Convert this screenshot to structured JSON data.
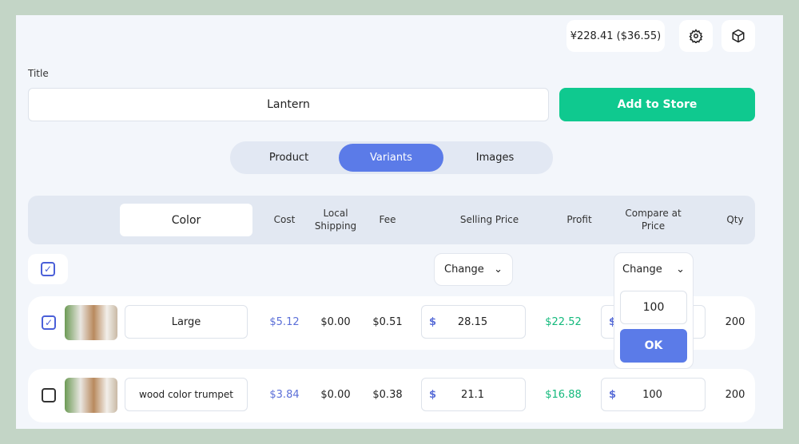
{
  "header": {
    "balance": "¥228.41 ($36.55)",
    "icons": [
      "gear-icon",
      "package-icon"
    ]
  },
  "title_label": "Title",
  "title_value": "Lantern",
  "add_button": "Add to Store",
  "tabs": [
    {
      "label": "Product"
    },
    {
      "label": "Variants",
      "active": true
    },
    {
      "label": "Images"
    }
  ],
  "columns": {
    "color": "Color",
    "cost": "Cost",
    "local_shipping": "Local Shipping",
    "fee": "Fee",
    "selling_price": "Selling Price",
    "profit": "Profit",
    "compare_at_price": "Compare at Price",
    "qty": "Qty"
  },
  "bulk": {
    "selling_change": "Change",
    "compare_change": "Change",
    "popup_value": "100",
    "ok": "OK"
  },
  "rows": [
    {
      "checked": true,
      "name": "Large",
      "cost": "$5.12",
      "shipping": "$0.00",
      "fee": "$0.51",
      "currency": "$",
      "selling": "28.15",
      "profit": "$22.52",
      "compare": "100",
      "qty": "200"
    },
    {
      "checked": false,
      "name": "wood color trumpet",
      "cost": "$3.84",
      "shipping": "$0.00",
      "fee": "$0.38",
      "currency": "$",
      "selling": "21.1",
      "profit": "$16.88",
      "compare": "100",
      "qty": "200"
    }
  ],
  "colors": {
    "accent": "#5b7be8",
    "green": "#0fc98f",
    "background": "#c3d5c6"
  }
}
